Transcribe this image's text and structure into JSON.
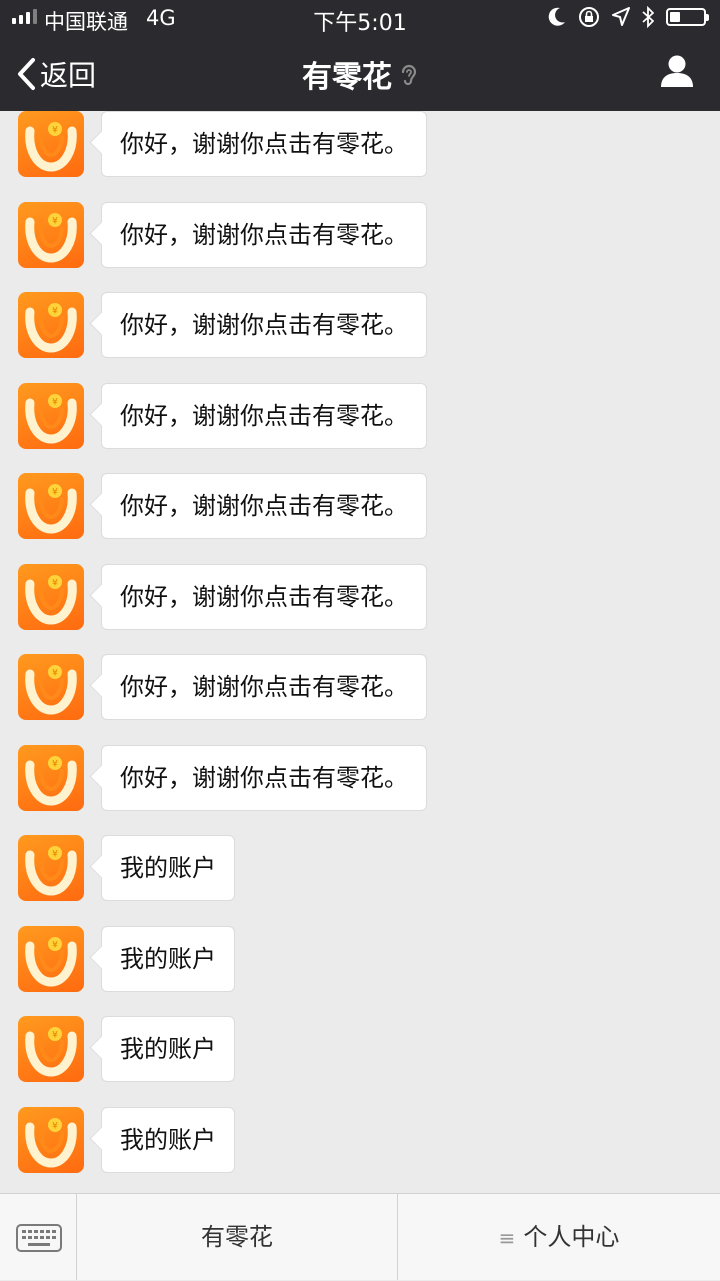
{
  "status_bar": {
    "carrier": "中国联通",
    "network": "4G",
    "time": "下午5:01",
    "battery_level": 0.3
  },
  "nav": {
    "back_label": "返回",
    "title": "有零花"
  },
  "messages": [
    {
      "text": "你好，谢谢你点击有零花。"
    },
    {
      "text": "你好，谢谢你点击有零花。"
    },
    {
      "text": "你好，谢谢你点击有零花。"
    },
    {
      "text": "你好，谢谢你点击有零花。"
    },
    {
      "text": "你好，谢谢你点击有零花。"
    },
    {
      "text": "你好，谢谢你点击有零花。"
    },
    {
      "text": "你好，谢谢你点击有零花。"
    },
    {
      "text": "你好，谢谢你点击有零花。"
    },
    {
      "text": "我的账户"
    },
    {
      "text": "我的账户"
    },
    {
      "text": "我的账户"
    },
    {
      "text": "我的账户"
    }
  ],
  "bottom_menu": {
    "items": [
      {
        "label": "有零花"
      },
      {
        "label": "个人中心"
      }
    ]
  },
  "icons": {
    "keyboard": "keyboard-icon",
    "profile": "person-icon",
    "back": "chevron-left-icon",
    "ear": "ear-icon",
    "menu": "menu-icon"
  },
  "colors": {
    "header": "#2b2a2f",
    "avatar_orange": "#ff7a12",
    "chat_bg": "#ebebeb"
  }
}
